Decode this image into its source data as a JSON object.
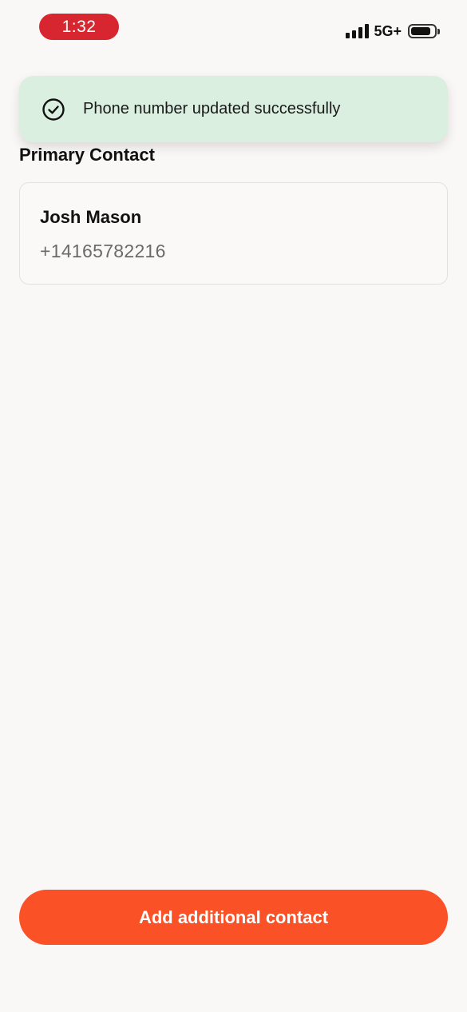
{
  "status_bar": {
    "time": "1:32",
    "network": "5G+",
    "icons": [
      "signal-icon",
      "battery-icon"
    ]
  },
  "toast": {
    "icon": "check-circle-icon",
    "message": "Phone number updated successfully",
    "background": "#daefe0"
  },
  "primary_contact": {
    "section_title": "Primary Contact",
    "name": "Josh Mason",
    "phone": "+14165782216"
  },
  "actions": {
    "add_contact_label": "Add additional contact",
    "button_color": "#fa5127"
  }
}
